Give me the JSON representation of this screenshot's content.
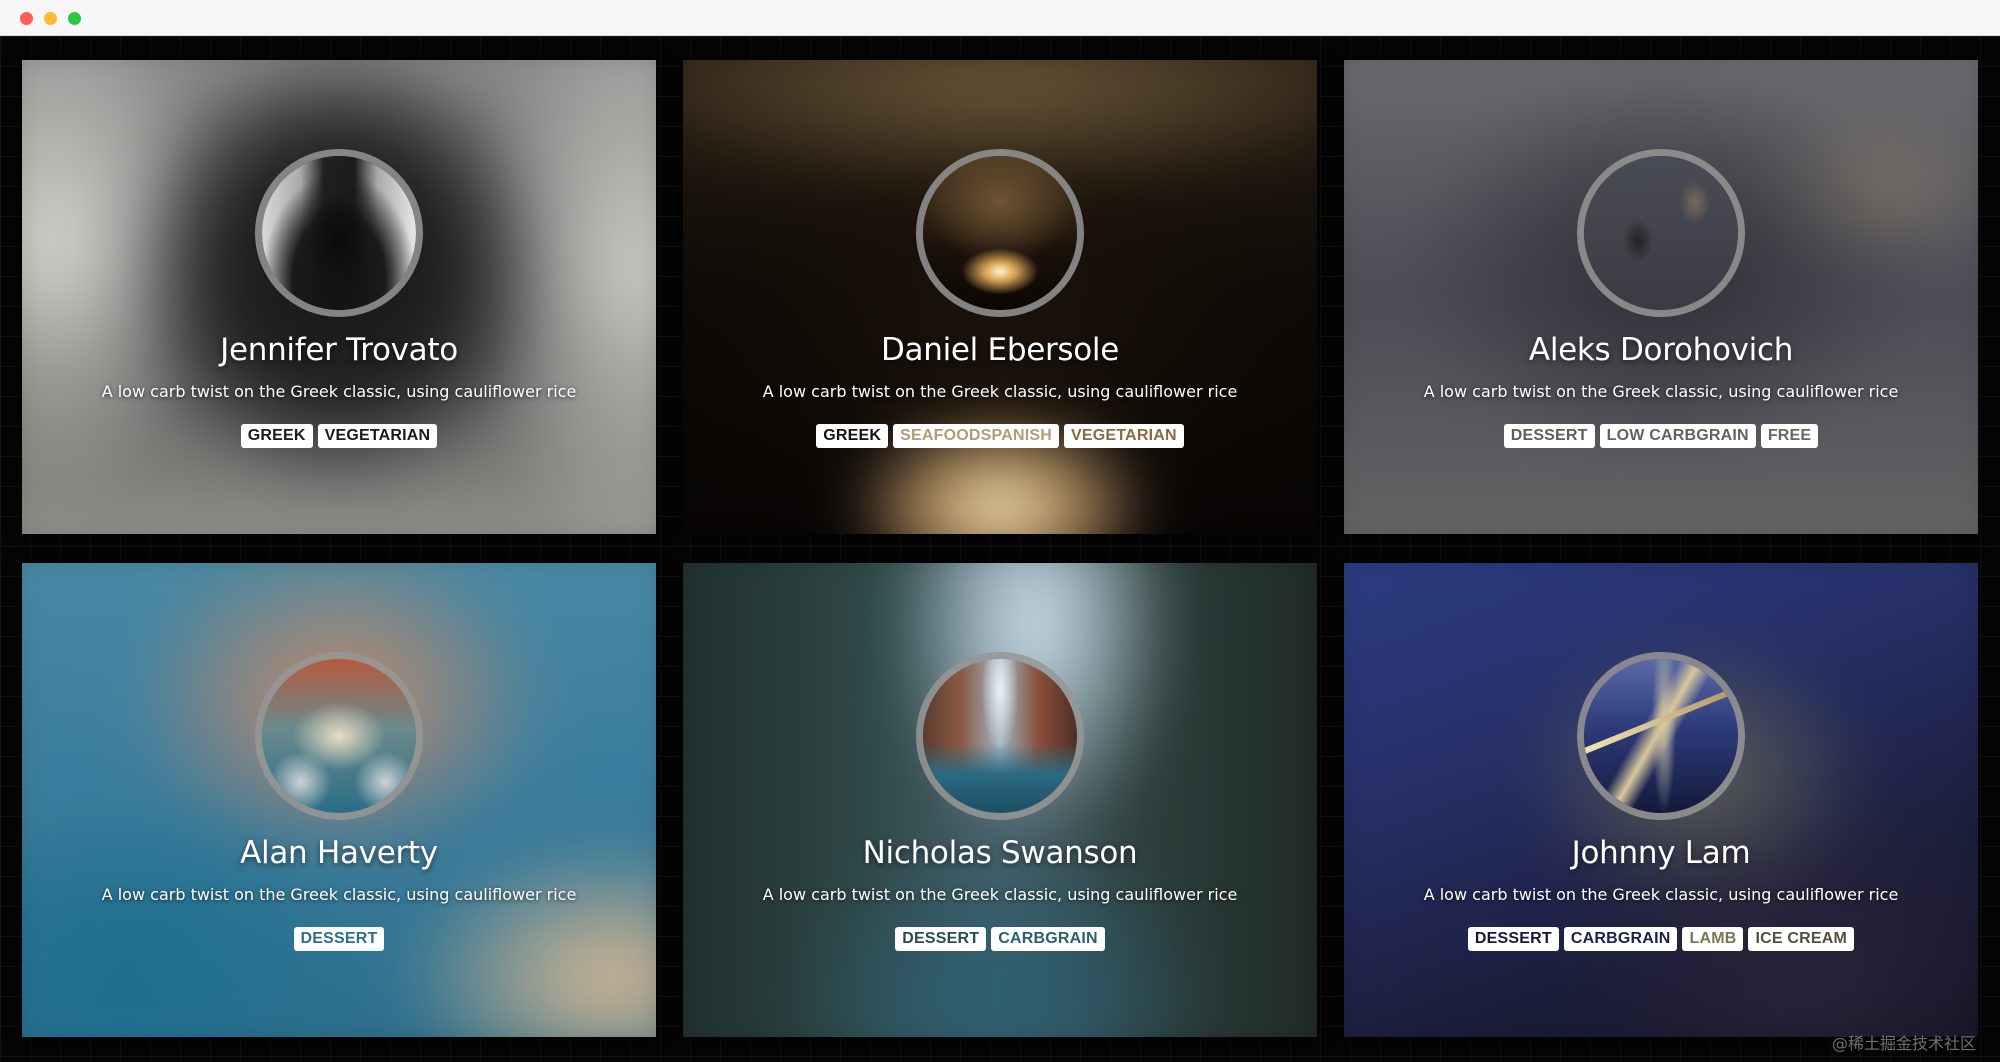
{
  "window": {
    "controls": [
      "close",
      "minimize",
      "zoom"
    ]
  },
  "cards": [
    {
      "name": "Jennifer Trovato",
      "description": "A low carb twist on the Greek classic, using cauliflower rice",
      "tags": [
        {
          "label": "GREEK",
          "color": "#1a1a1a"
        },
        {
          "label": "VEGETARIAN",
          "color": "#1a1a1a"
        }
      ]
    },
    {
      "name": "Daniel Ebersole",
      "description": "A low carb twist on the Greek classic, using cauliflower rice",
      "tags": [
        {
          "label": "GREEK",
          "color": "#1a120c"
        },
        {
          "label": "SEAFOODSPANISH",
          "color": "#b79a72"
        },
        {
          "label": "VEGETARIAN",
          "color": "#8a6a42"
        }
      ]
    },
    {
      "name": "Aleks Dorohovich",
      "description": "A low carb twist on the Greek classic, using cauliflower rice",
      "tags": [
        {
          "label": "DESSERT",
          "color": "#5f5c5a"
        },
        {
          "label": "LOW CARBGRAIN",
          "color": "#65615e"
        },
        {
          "label": "FREE",
          "color": "#6a6664"
        }
      ]
    },
    {
      "name": "Alan Haverty",
      "description": "A low carb twist on the Greek classic, using cauliflower rice",
      "tags": [
        {
          "label": "DESSERT",
          "color": "#2e6e8a"
        }
      ]
    },
    {
      "name": "Nicholas Swanson",
      "description": "A low carb twist on the Greek classic, using cauliflower rice",
      "tags": [
        {
          "label": "DESSERT",
          "color": "#2a4b55"
        },
        {
          "label": "CARBGRAIN",
          "color": "#2c5f6e"
        }
      ]
    },
    {
      "name": "Johnny Lam",
      "description": "A low carb twist on the Greek classic, using cauliflower rice",
      "tags": [
        {
          "label": "DESSERT",
          "color": "#15183a"
        },
        {
          "label": "CARBGRAIN",
          "color": "#1b2149"
        },
        {
          "label": "LAMB",
          "color": "#7f7450"
        },
        {
          "label": "ICE CREAM",
          "color": "#574f3d"
        }
      ]
    }
  ],
  "watermark": "@稀土掘金技术社区"
}
